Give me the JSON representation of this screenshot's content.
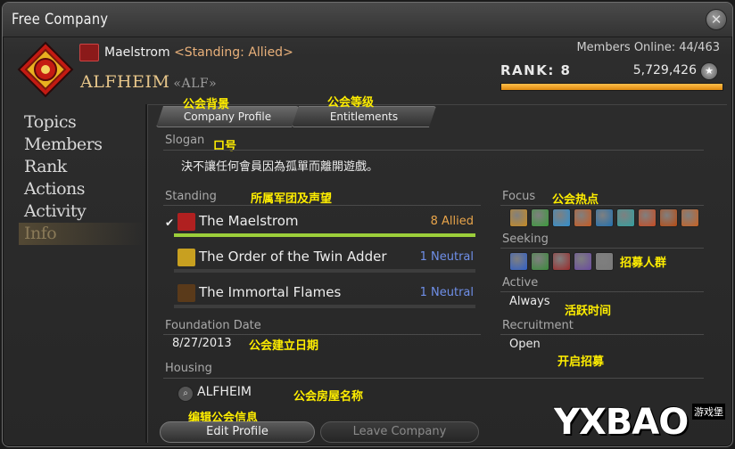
{
  "window": {
    "title": "Free Company",
    "close_glyph": "✕"
  },
  "header": {
    "grand_company": "Maelstrom",
    "standing": "<Standing: Allied>",
    "fc_name": "ALFHEIM",
    "fc_tag": "«ALF»",
    "members_online": "Members Online: 44/463",
    "rank_label": "RANK: 8",
    "rank_points": "5,729,426",
    "rank_progress": 1.0
  },
  "sidebar": {
    "items": [
      {
        "label": "Topics"
      },
      {
        "label": "Members"
      },
      {
        "label": "Rank"
      },
      {
        "label": "Actions"
      },
      {
        "label": "Activity"
      },
      {
        "label": "Info",
        "active": true
      }
    ]
  },
  "tabs": [
    {
      "label": "Company Profile",
      "active": true
    },
    {
      "label": "Entitlements"
    }
  ],
  "slogan": {
    "label": "Slogan",
    "value": "決不讓任何會員因為孤單而離開遊戲。"
  },
  "standing": {
    "label": "Standing",
    "rows": [
      {
        "name": "The Maelstrom",
        "rank": "8 Allied",
        "rank_color": "#e8a44a",
        "bar_color": "#9ccf3a",
        "progress": 1.0,
        "icon_color": "#b02020",
        "selected": true
      },
      {
        "name": "The Order of the Twin Adder",
        "rank": "1 Neutral",
        "rank_color": "#6f8fe8",
        "bar_color": "#9ccf3a",
        "progress": 0.0,
        "icon_color": "#c8a020"
      },
      {
        "name": "The Immortal Flames",
        "rank": "1 Neutral",
        "rank_color": "#6f8fe8",
        "bar_color": "#9ccf3a",
        "progress": 0.0,
        "icon_color": "#5a3a1a"
      }
    ],
    "check_glyph": "✔"
  },
  "foundation": {
    "label": "Foundation Date",
    "value": "8/27/2013"
  },
  "housing": {
    "label": "Housing",
    "value": "ALFHEIM"
  },
  "focus": {
    "label": "Focus",
    "icons": [
      {
        "name": "role-playing-icon",
        "color": "#c88a20"
      },
      {
        "name": "leveling-icon",
        "color": "#3a9a3a"
      },
      {
        "name": "casual-icon",
        "color": "#2f8fd0"
      },
      {
        "name": "hardcore-icon",
        "color": "#c85a20"
      },
      {
        "name": "dungeons-icon",
        "color": "#2070b0"
      },
      {
        "name": "guildhests-icon",
        "color": "#30a0a0"
      },
      {
        "name": "trials-icon",
        "color": "#c84a20"
      },
      {
        "name": "raids-icon",
        "color": "#b84a10"
      },
      {
        "name": "pvp-icon",
        "color": "#c86020"
      }
    ]
  },
  "seeking": {
    "label": "Seeking",
    "icons": [
      {
        "name": "tank-icon",
        "color": "#2f5fc8"
      },
      {
        "name": "healer-icon",
        "color": "#3a8a3a"
      },
      {
        "name": "dps-icon",
        "color": "#9a2a2a"
      },
      {
        "name": "crafter-icon",
        "color": "#6a4aa0"
      },
      {
        "name": "gatherer-icon",
        "color": "#7a7a7a"
      }
    ]
  },
  "active": {
    "label": "Active",
    "value": "Always"
  },
  "recruitment": {
    "label": "Recruitment",
    "value": "Open"
  },
  "buttons": {
    "edit_profile": "Edit Profile",
    "leave_company": "Leave Company"
  },
  "annotations": {
    "company_profile": "公会背景",
    "entitlements": "公会等级",
    "slogan": "口号",
    "standing": "所属军团及声望",
    "focus": "公会热点",
    "seeking": "招募人群",
    "active": "活跃时间",
    "foundation": "公会建立日期",
    "recruitment": "开启招募",
    "housing": "公会房屋名称",
    "edit": "编辑公会信息"
  },
  "watermark": {
    "text": "YXBAO",
    "cn": "游戏堡"
  },
  "colors": {
    "label_gray": "#a9a9a9",
    "annotation_yellow": "#ffee00",
    "fc_name_gold": "#e7c68a",
    "rank_bar": "#f0a020"
  }
}
